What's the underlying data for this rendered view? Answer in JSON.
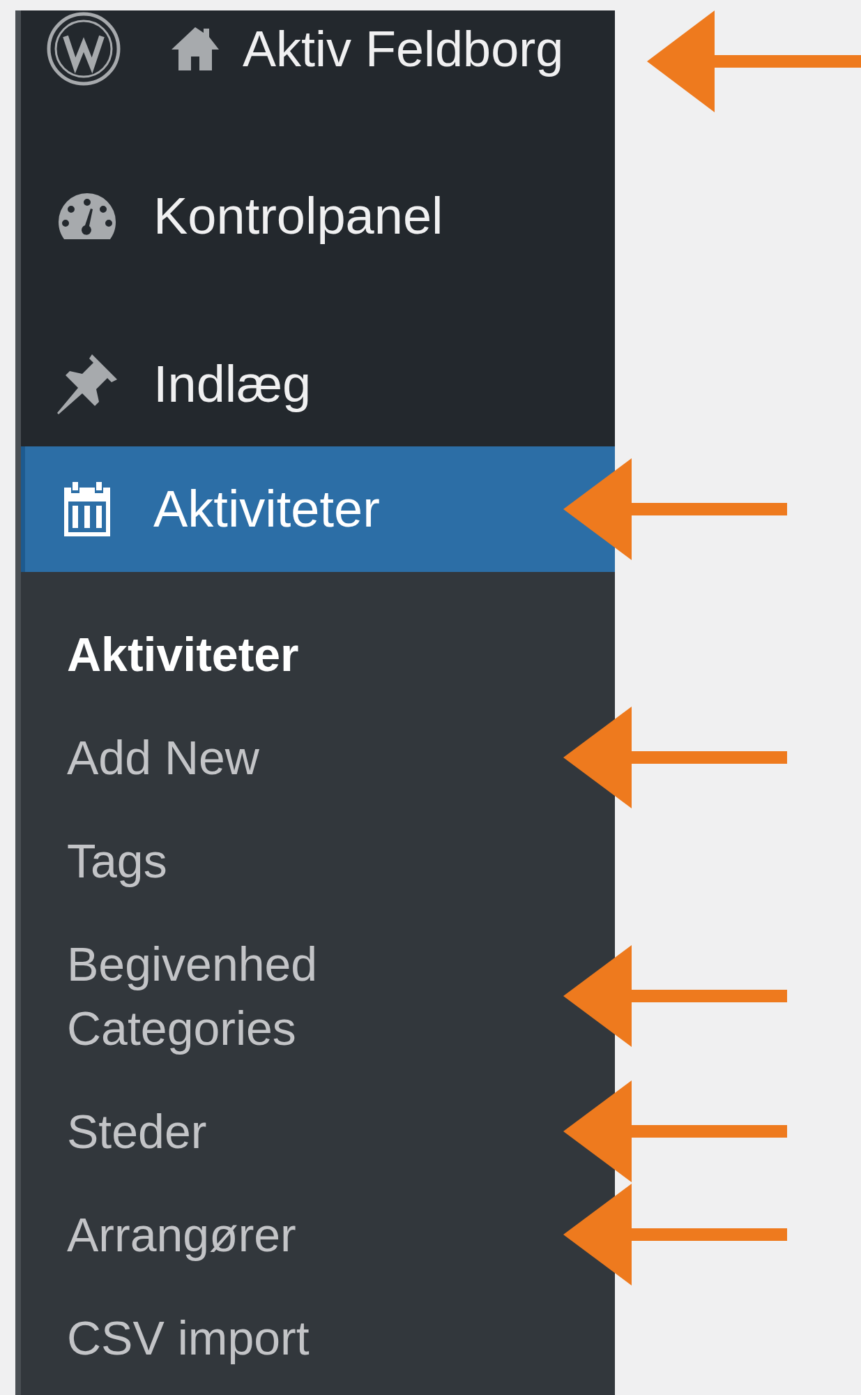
{
  "admin_bar": {
    "site_title": "Aktiv Feldborg",
    "marked": true
  },
  "menu": [
    {
      "label": "Kontrolpanel",
      "kind": "dashboard",
      "selected": false,
      "marked": false
    },
    {
      "label": "Indlæg",
      "kind": "pin",
      "selected": false,
      "marked": false
    },
    {
      "label": "Aktiviteter",
      "kind": "calendar",
      "selected": true,
      "marked": true
    }
  ],
  "submenu": [
    {
      "label": "Aktiviteter",
      "selected": true,
      "marked": false
    },
    {
      "label": "Add New",
      "selected": false,
      "marked": true
    },
    {
      "label": "Tags",
      "selected": false,
      "marked": false
    },
    {
      "label": "Begivenhed Categories",
      "selected": false,
      "marked": true
    },
    {
      "label": "Steder",
      "selected": false,
      "marked": true
    },
    {
      "label": "Arrangører",
      "selected": false,
      "marked": true
    },
    {
      "label": "CSV import",
      "selected": false,
      "marked": false
    }
  ]
}
